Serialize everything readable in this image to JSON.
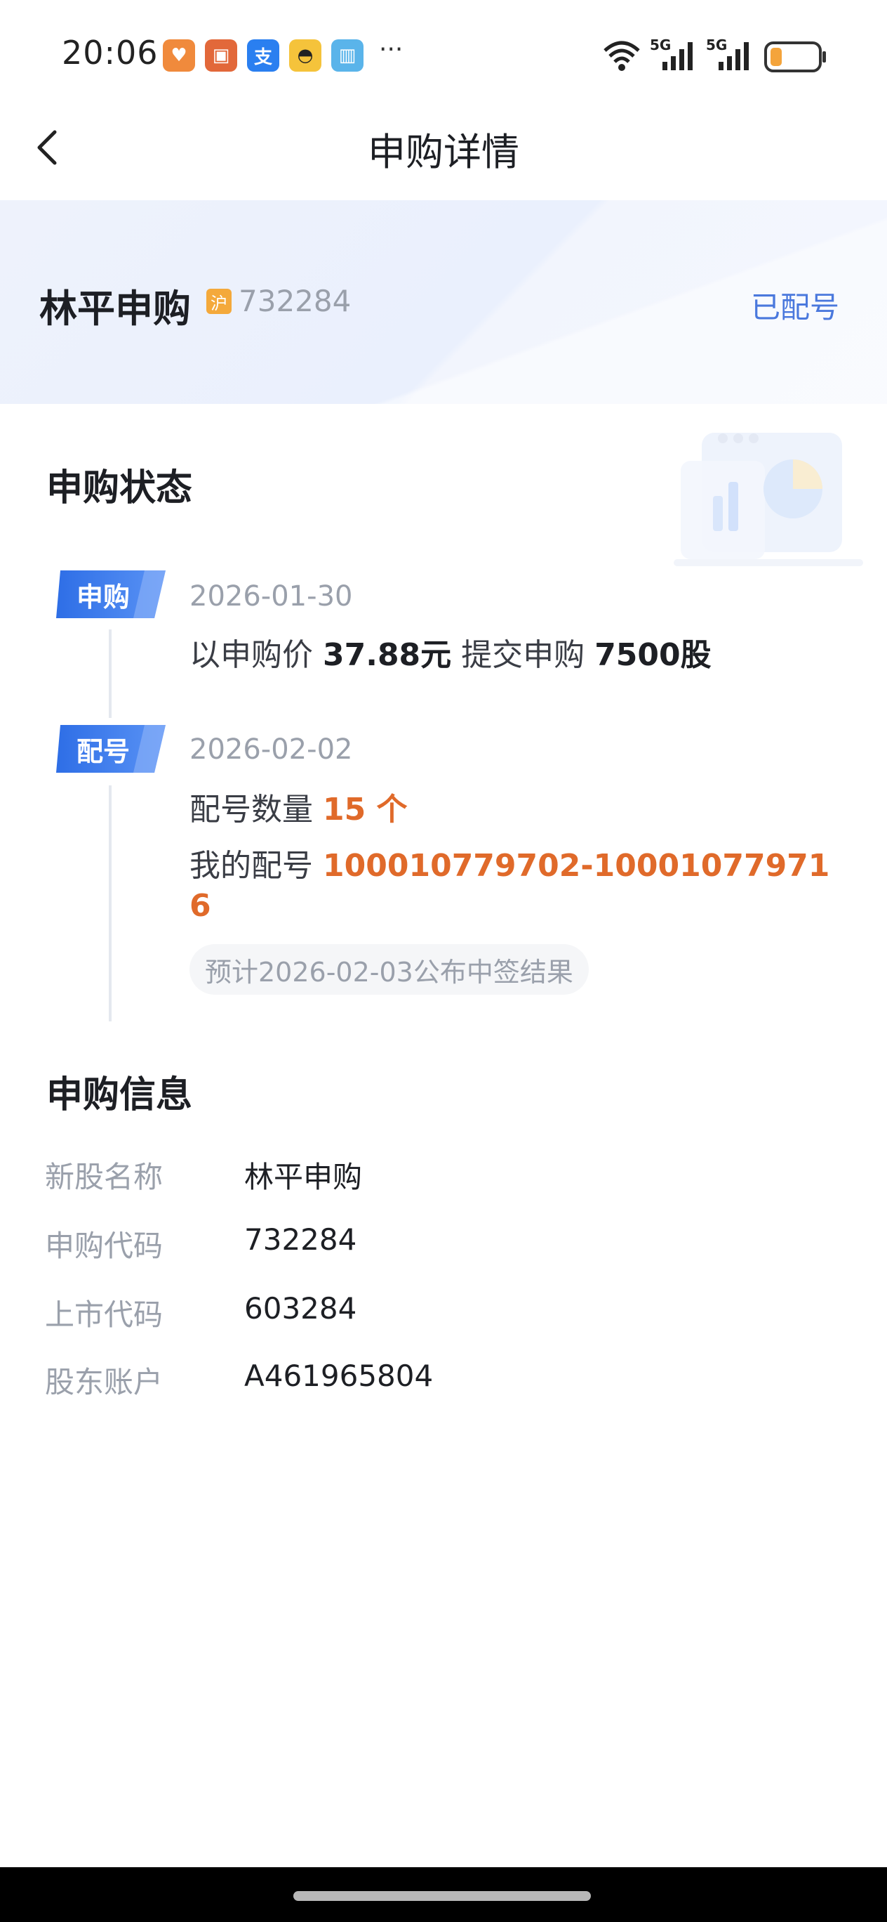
{
  "status_bar": {
    "time": "20:06",
    "more": "···",
    "signal_1": "5G",
    "signal_2": "5G",
    "icons": [
      "heart-app-icon",
      "wallet-app-icon",
      "alipay-app-icon",
      "car-app-icon",
      "book-app-icon",
      "wifi-icon",
      "signal-icon",
      "battery-icon"
    ]
  },
  "header": {
    "title": "申购详情"
  },
  "stock": {
    "name": "林平申购",
    "market": "沪",
    "code": "732284",
    "status": "已配号"
  },
  "status_section": {
    "title": "申购状态",
    "steps": [
      {
        "badge": "申购",
        "date": "2026-01-30",
        "prefix": "以申购价",
        "price": "37.88元",
        "mid": "提交申购",
        "shares": "7500股"
      },
      {
        "badge": "配号",
        "date": "2026-02-02",
        "count_label": "配号数量",
        "count_value": "15 个",
        "range_label": "我的配号",
        "range_value_1": "100010779702-10001077971",
        "range_value_2": "6",
        "notice": "预计2026-02-03公布中签结果"
      }
    ]
  },
  "info_section": {
    "title": "申购信息",
    "rows": [
      {
        "label": "新股名称",
        "value": "林平申购"
      },
      {
        "label": "申购代码",
        "value": "732284"
      },
      {
        "label": "上市代码",
        "value": "603284"
      },
      {
        "label": "股东账户",
        "value": "A461965804"
      }
    ]
  },
  "colors": {
    "accent": "#4a78dd",
    "highlight": "#e06a2a",
    "badge": "#2f6fe6",
    "market_badge": "#f4a93b"
  }
}
